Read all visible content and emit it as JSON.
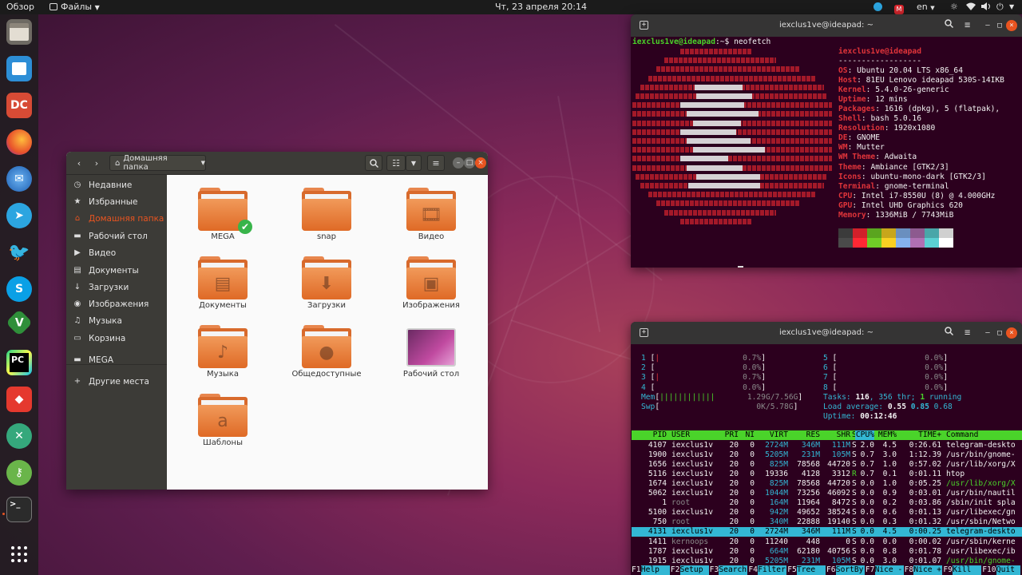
{
  "topbar": {
    "overview": "Обзор",
    "app_menu": "Файлы",
    "clock": "Чт, 23 апреля  20:14",
    "lang": "en"
  },
  "dock": {
    "apps": [
      "files",
      "software-store",
      "dictionary",
      "firefox",
      "thunderbird",
      "telegram",
      "tweet",
      "skype",
      "vim",
      "pycharm",
      "anydesk",
      "crossover",
      "keepass",
      "terminal",
      "app-grid"
    ]
  },
  "nautilus": {
    "location": "Домашняя папка",
    "sidebar": [
      {
        "label": "Недавние",
        "icon": "clock-icon"
      },
      {
        "label": "Избранные",
        "icon": "star-icon"
      },
      {
        "label": "Домашняя папка",
        "icon": "home-icon",
        "active": true
      },
      {
        "label": "Рабочий стол",
        "icon": "folder-icon"
      },
      {
        "label": "Видео",
        "icon": "video-icon"
      },
      {
        "label": "Документы",
        "icon": "document-icon"
      },
      {
        "label": "Загрузки",
        "icon": "download-icon"
      },
      {
        "label": "Изображения",
        "icon": "camera-icon"
      },
      {
        "label": "Музыка",
        "icon": "music-icon"
      },
      {
        "label": "Корзина",
        "icon": "trash-icon"
      },
      {
        "label": "MEGA",
        "icon": "drive-icon"
      },
      {
        "label": "Другие места",
        "icon": "plus-icon"
      }
    ],
    "folders": [
      {
        "label": "MEGA",
        "emblem": "check"
      },
      {
        "label": "snap",
        "emblem": ""
      },
      {
        "label": "Видео",
        "emblem": "film"
      },
      {
        "label": "Документы",
        "emblem": "doc"
      },
      {
        "label": "Загрузки",
        "emblem": "down"
      },
      {
        "label": "Изображения",
        "emblem": "photo"
      },
      {
        "label": "Музыка",
        "emblem": "note"
      },
      {
        "label": "Общедоступные",
        "emblem": "person"
      },
      {
        "label": "Рабочий стол",
        "emblem": "desktop"
      },
      {
        "label": "Шаблоны",
        "emblem": "template"
      }
    ]
  },
  "term1": {
    "title": "iexclus1ve@ideapad: ~",
    "prompt_user": "iexclus1ve@ideapad",
    "prompt_rest": ":~$ neofetch",
    "header": "iexclus1ve@ideapad",
    "sep": "------------------",
    "info": [
      {
        "k": "OS",
        "v": "Ubuntu 20.04 LTS x86_64"
      },
      {
        "k": "Host",
        "v": "81EU Lenovo ideapad 530S-14IKB"
      },
      {
        "k": "Kernel",
        "v": "5.4.0-26-generic"
      },
      {
        "k": "Uptime",
        "v": "12 mins"
      },
      {
        "k": "Packages",
        "v": "1616 (dpkg), 5 (flatpak),"
      },
      {
        "k": "Shell",
        "v": "bash 5.0.16"
      },
      {
        "k": "Resolution",
        "v": "1920x1080"
      },
      {
        "k": "DE",
        "v": "GNOME"
      },
      {
        "k": "WM",
        "v": "Mutter"
      },
      {
        "k": "WM Theme",
        "v": "Adwaita"
      },
      {
        "k": "Theme",
        "v": "Ambiance [GTK2/3]"
      },
      {
        "k": "Icons",
        "v": "ubuntu-mono-dark [GTK2/3]"
      },
      {
        "k": "Terminal",
        "v": "gnome-terminal"
      },
      {
        "k": "CPU",
        "v": "Intel i7-8550U (8) @ 4.000GHz"
      },
      {
        "k": "GPU",
        "v": "Intel UHD Graphics 620"
      },
      {
        "k": "Memory",
        "v": "1336MiB / 7743MiB"
      }
    ],
    "palette": [
      "#3b3b3b",
      "#d1202a",
      "#5aa51f",
      "#c7a61b",
      "#6a8fbf",
      "#8d5a8f",
      "#49a6a8",
      "#d0d0d0"
    ]
  },
  "term2": {
    "title": "iexclus1ve@ideapad: ~",
    "cpus_left": [
      {
        "n": "1",
        "pct": "0.7%"
      },
      {
        "n": "2",
        "pct": "0.0%"
      },
      {
        "n": "3",
        "pct": "0.7%"
      },
      {
        "n": "4",
        "pct": "0.0%"
      }
    ],
    "cpus_right": [
      {
        "n": "5",
        "pct": "0.0%"
      },
      {
        "n": "6",
        "pct": "0.0%"
      },
      {
        "n": "7",
        "pct": "0.0%"
      },
      {
        "n": "8",
        "pct": "0.0%"
      }
    ],
    "mem": "1.29G/7.56G",
    "swp": "0K/5.78G",
    "tasks_a": "Tasks: ",
    "tasks_n": "116",
    "tasks_b": ", 356 thr; ",
    "tasks_r": "1",
    "tasks_c": " running",
    "load_a": "Load average: ",
    "load_1": "0.55",
    "load_5": "0.85",
    "load_15": "0.68",
    "uptime_a": "Uptime: ",
    "uptime_v": "00:12:46",
    "cols": [
      "PID",
      "USER",
      "PRI",
      "NI",
      "VIRT",
      "RES",
      "SHR",
      "S",
      "CPU%",
      "MEM%",
      "TIME+",
      "Command"
    ],
    "rows": [
      [
        "4107",
        "iexclus1v",
        "20",
        "0",
        "2724M",
        "346M",
        "111M",
        "S",
        "2.0",
        "4.5",
        "0:26.61",
        "telegram-deskto"
      ],
      [
        "1900",
        "iexclus1v",
        "20",
        "0",
        "5205M",
        "231M",
        "105M",
        "S",
        "0.7",
        "3.0",
        "1:12.39",
        "/usr/bin/gnome-"
      ],
      [
        "1656",
        "iexclus1v",
        "20",
        "0",
        "825M",
        "78568",
        "44720",
        "S",
        "0.7",
        "1.0",
        "0:57.02",
        "/usr/lib/xorg/X"
      ],
      [
        "5116",
        "iexclus1v",
        "20",
        "0",
        "19336",
        "4128",
        "3312",
        "R",
        "0.7",
        "0.1",
        "0:01.11",
        "htop"
      ],
      [
        "1674",
        "iexclus1v",
        "20",
        "0",
        "825M",
        "78568",
        "44720",
        "S",
        "0.0",
        "1.0",
        "0:05.25",
        "/usr/lib/xorg/X"
      ],
      [
        "5062",
        "iexclus1v",
        "20",
        "0",
        "1044M",
        "73256",
        "46092",
        "S",
        "0.0",
        "0.9",
        "0:03.01",
        "/usr/bin/nautil"
      ],
      [
        "1",
        "root",
        "20",
        "0",
        "164M",
        "11964",
        "8472",
        "S",
        "0.0",
        "0.2",
        "0:03.86",
        "/sbin/init spla"
      ],
      [
        "5100",
        "iexclus1v",
        "20",
        "0",
        "942M",
        "49652",
        "38524",
        "S",
        "0.0",
        "0.6",
        "0:01.13",
        "/usr/libexec/gn"
      ],
      [
        "750",
        "root",
        "20",
        "0",
        "340M",
        "22888",
        "19140",
        "S",
        "0.0",
        "0.3",
        "0:01.32",
        "/usr/sbin/Netwo"
      ],
      [
        "4131",
        "iexclus1v",
        "20",
        "0",
        "2724M",
        "346M",
        "111M",
        "S",
        "0.0",
        "4.5",
        "0:00.25",
        "telegram-deskto"
      ],
      [
        "1411",
        "kernoops",
        "20",
        "0",
        "11240",
        "448",
        "0",
        "S",
        "0.0",
        "0.0",
        "0:00.02",
        "/usr/sbin/kerne"
      ],
      [
        "1787",
        "iexclus1v",
        "20",
        "0",
        "664M",
        "62180",
        "40756",
        "S",
        "0.0",
        "0.8",
        "0:01.78",
        "/usr/libexec/ib"
      ],
      [
        "1915",
        "iexclus1v",
        "20",
        "0",
        "5205M",
        "231M",
        "105M",
        "S",
        "0.0",
        "3.0",
        "0:01.07",
        "/usr/bin/gnome-"
      ]
    ],
    "fkeys": [
      {
        "k": "F1",
        "l": "Help"
      },
      {
        "k": "F2",
        "l": "Setup"
      },
      {
        "k": "F3",
        "l": "Search"
      },
      {
        "k": "F4",
        "l": "Filter"
      },
      {
        "k": "F5",
        "l": "Tree"
      },
      {
        "k": "F6",
        "l": "SortBy"
      },
      {
        "k": "F7",
        "l": "Nice -"
      },
      {
        "k": "F8",
        "l": "Nice +"
      },
      {
        "k": "F9",
        "l": "Kill"
      },
      {
        "k": "F10",
        "l": "Quit"
      }
    ]
  }
}
